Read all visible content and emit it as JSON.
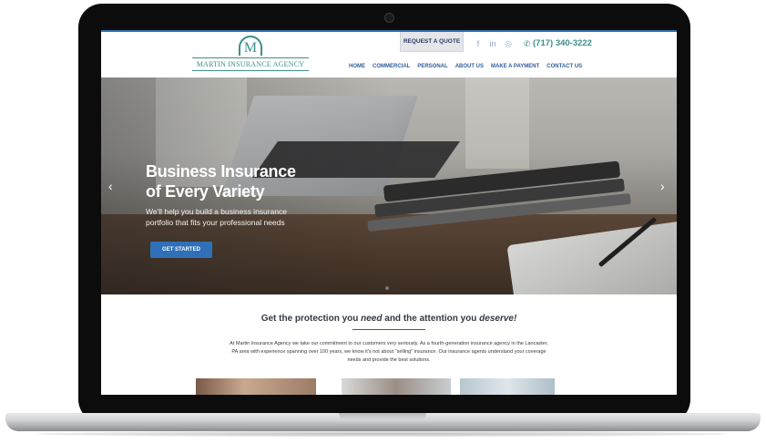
{
  "header": {
    "logo_letter": "M",
    "logo_text": "MARTIN INSURANCE AGENCY",
    "request_quote": "REQUEST A QUOTE",
    "social": [
      {
        "icon": "facebook-icon",
        "glyph": "f"
      },
      {
        "icon": "linkedin-icon",
        "glyph": "in"
      },
      {
        "icon": "instagram-icon",
        "glyph": "◎"
      }
    ],
    "phone": "(717) 340-3222",
    "phone_glyph": "✆"
  },
  "nav": [
    "HOME",
    "COMMERCIAL",
    "PERSONAL",
    "ABOUT US",
    "MAKE A PAYMENT",
    "CONTACT US"
  ],
  "hero": {
    "title_line1": "Business Insurance",
    "title_line2": "of Every Variety",
    "subtitle_line1": "We'll help you build a business insurance",
    "subtitle_line2": "portfolio that fits your professional needs",
    "button": "GET STARTED",
    "prev_glyph": "‹",
    "next_glyph": "›",
    "slide_count": 4,
    "active_slide": 2
  },
  "content": {
    "tagline_part1": "Get the protection you ",
    "tagline_em1": "need",
    "tagline_part2": " and the attention you ",
    "tagline_em2": "deserve!",
    "paragraph_line1": "At Martin Insurance Agency we take our commitment to our customers very seriously. As a fourth-generation insurance agency in the Lancaster,",
    "paragraph_line2": "PA area with experience spanning over 100 years, we know it's not about \"selling\" insurance. Our insurance agents understand your coverage",
    "paragraph_line3": "needs and provide the best solutions."
  },
  "colors": {
    "accent_teal": "#3d8f8b",
    "nav_blue": "#2e5f9a",
    "button_blue": "#2f70b8"
  }
}
